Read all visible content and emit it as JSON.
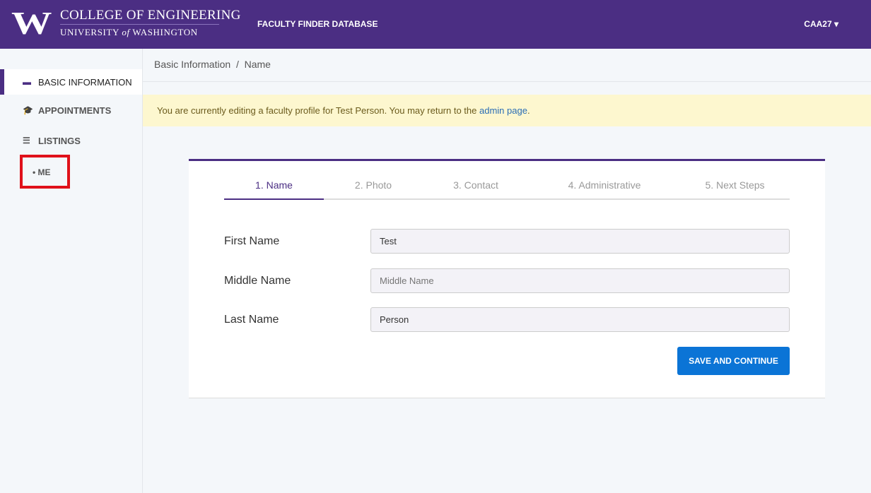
{
  "header": {
    "logo_letter": "W",
    "college": "COLLEGE OF ENGINEERING",
    "university_pre": "UNIVERSITY",
    "university_of": "of",
    "university_post": "WASHINGTON",
    "app_title": "FACULTY FINDER DATABASE",
    "user": "CAA27 ▾"
  },
  "sidebar": {
    "items": [
      {
        "label": "BASIC INFORMATION",
        "icon": "id-card-icon"
      },
      {
        "label": "APPOINTMENTS",
        "icon": "graduation-cap-icon"
      },
      {
        "label": "LISTINGS",
        "icon": "list-icon"
      },
      {
        "label": "• ME"
      }
    ]
  },
  "breadcrumb": {
    "parent": "Basic Information",
    "sep": "/",
    "current": "Name"
  },
  "alert": {
    "text": "You are currently editing a faculty profile for Test Person. You may return to the ",
    "link": "admin page",
    "end": "."
  },
  "steps": [
    "1. Name",
    "2. Photo",
    "3. Contact",
    "4. Administrative",
    "5. Next Steps"
  ],
  "form": {
    "first_label": "First Name",
    "first_value": "Test",
    "middle_label": "Middle Name",
    "middle_placeholder": "Middle Name",
    "last_label": "Last Name",
    "last_value": "Person",
    "submit": "SAVE AND CONTINUE"
  },
  "colors": {
    "brand": "#4b2e83",
    "button": "#0b74d6",
    "highlight": "#e0111a"
  }
}
